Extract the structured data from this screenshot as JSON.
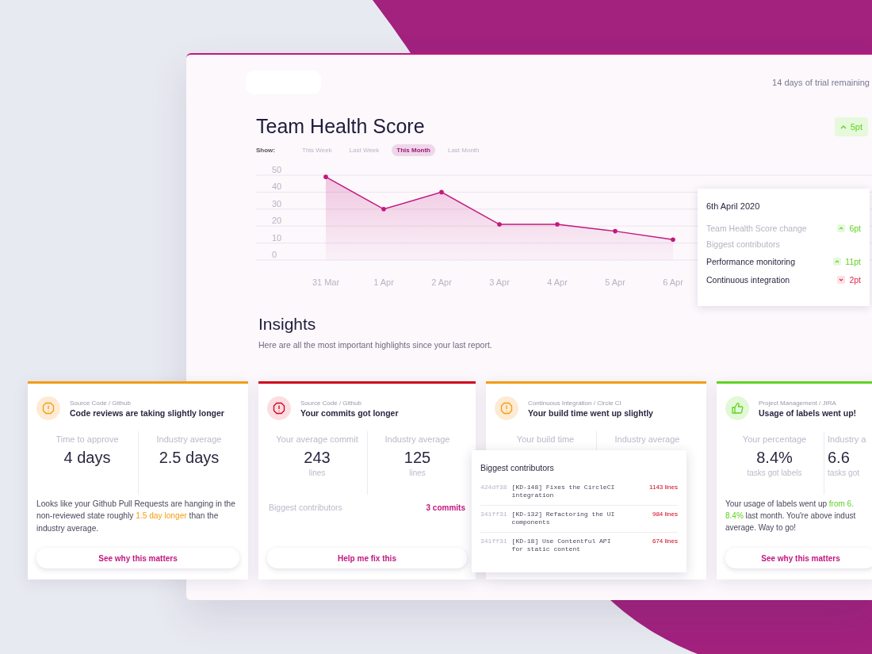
{
  "header": {
    "trial": "14 days of trial remaining"
  },
  "score": {
    "title": "Team Health Score",
    "badge": {
      "increase": true,
      "value": "5pt"
    },
    "filter": {
      "label": "Show:",
      "tabs": [
        {
          "label": "This Week",
          "selected": false
        },
        {
          "label": "Last Week",
          "selected": false
        },
        {
          "label": "This Month",
          "selected": true
        },
        {
          "label": "Last Month",
          "selected": false
        }
      ]
    },
    "chart_data": {
      "type": "area",
      "categories": [
        "31 Mar",
        "1 Apr",
        "2 Apr",
        "3 Apr",
        "4 Apr",
        "5 Apr",
        "6 Apr"
      ],
      "series": [
        {
          "color": "#c2177f",
          "values": [
            49,
            30,
            40,
            21,
            21,
            17,
            12
          ]
        }
      ],
      "ylim": [
        0,
        50
      ],
      "yticks": [
        0,
        10,
        20,
        30,
        40,
        50
      ],
      "grid": true
    },
    "tooltip": {
      "date": "6th April 2020",
      "rows": [
        {
          "kind": "summary",
          "label": "Team Health Score change",
          "increase": true,
          "value": "6pt"
        },
        {
          "kind": "heading",
          "label": "Biggest contributors"
        },
        {
          "kind": "item",
          "label": "Performance monitoring",
          "increase": true,
          "value": "11pt"
        },
        {
          "kind": "item",
          "label": "Continuous integration",
          "increase": false,
          "value": "2pt"
        }
      ]
    }
  },
  "insights": {
    "title": "Insights",
    "subtitle": "Here are all the most important highlights since your last report.",
    "cards": [
      {
        "kind": "warning",
        "category": "Source Code / Github",
        "title": "Code reviews are taking slightly longer",
        "metrics": [
          {
            "label": "Time to approve",
            "value": "4 days"
          },
          {
            "label": "Industry average",
            "value": "2.5 days"
          }
        ],
        "body": [
          {
            "text": "Looks like your Github Pull Requests are hanging in the non-reviewed state roughly ",
            "highlight": false
          },
          {
            "text": "1.5 day longer",
            "highlight": true
          },
          {
            "text": " than the industry average.",
            "highlight": false
          }
        ],
        "button": "See why this matters"
      },
      {
        "kind": "error",
        "category": "Source Code / Github",
        "title": "Your commits got longer",
        "metrics": [
          {
            "label": "Your average commit",
            "value": "243",
            "unit": "lines"
          },
          {
            "label": "Industry average",
            "value": "125",
            "unit": "lines"
          }
        ],
        "contributors": {
          "label": "Biggest contributors",
          "link": "3 commits"
        },
        "button": "Help me fix this"
      },
      {
        "kind": "warning",
        "category": "Continuous Integration / Circle CI",
        "title": "Your build time went up slightly",
        "metrics": [
          {
            "label": "Your build time"
          },
          {
            "label": "Industry average"
          }
        ]
      },
      {
        "kind": "success",
        "category": "Project Management / JIRA",
        "title": "Usage of labels went up!",
        "metrics": [
          {
            "label": "Your percentage",
            "value": "8.4%",
            "unit": "tasks got labels"
          },
          {
            "label": "Industry a",
            "value": "6.6",
            "unit": "tasks got"
          }
        ],
        "body": [
          {
            "text": "Your usage of labels went up ",
            "highlight": false
          },
          {
            "text": "from 6.\n8.4%",
            "highlight": true
          },
          {
            "text": " last month. You're above indust\naverage. Way to go!",
            "highlight": false
          }
        ],
        "button": "See why this matters"
      }
    ],
    "popover": {
      "title": "Biggest contributors",
      "commits": [
        {
          "hash": "424df38",
          "message": "[KD-148] Fixes the CircleCI integration",
          "lines": "1143 lines"
        },
        {
          "hash": "341ff31",
          "message": "[KD-132] Refactoring the UI components",
          "lines": "984 lines"
        },
        {
          "hash": "341ff31",
          "message": "[KD-18] Use Contentful API for static content",
          "lines": "674 lines"
        }
      ]
    }
  }
}
